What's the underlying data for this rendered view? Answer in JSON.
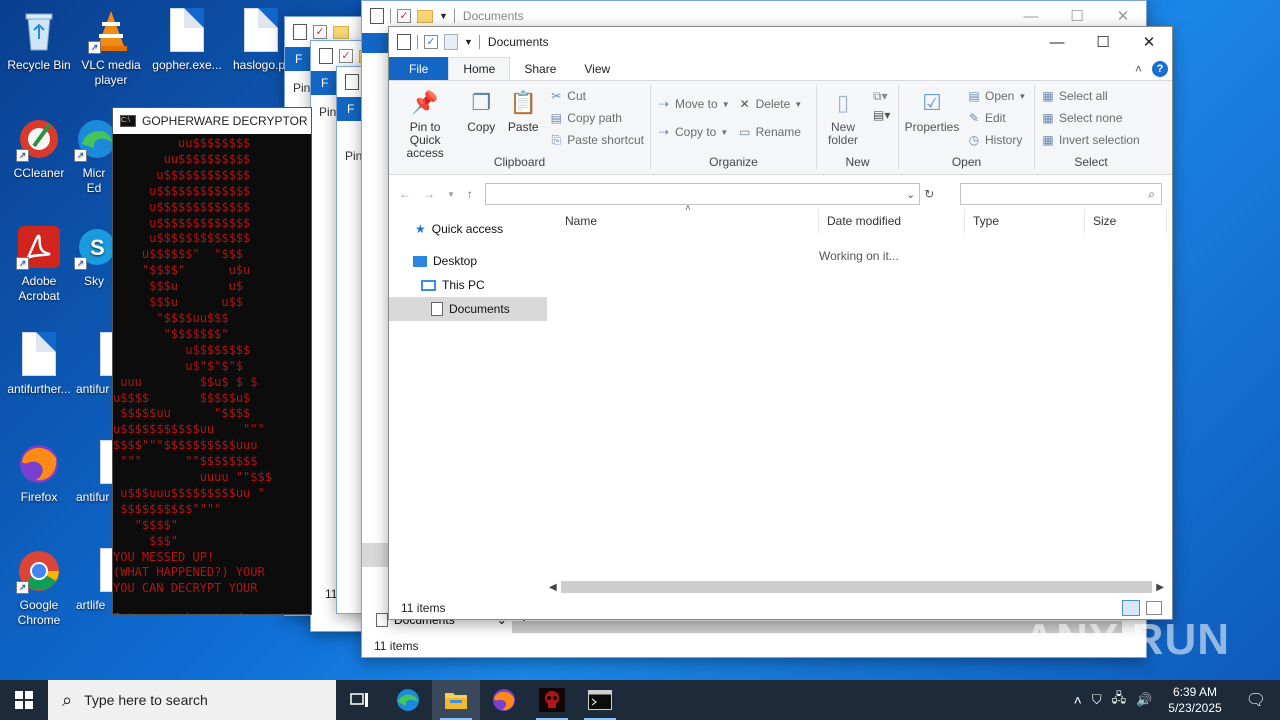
{
  "desktop": {
    "icons": [
      {
        "label": "Recycle Bin"
      },
      {
        "label": "VLC media player"
      },
      {
        "label": "gopher.exe..."
      },
      {
        "label": "haslogo.pr"
      },
      {
        "label": "CCleaner"
      },
      {
        "label": "Micr Ed"
      },
      {
        "label": "Adobe Acrobat"
      },
      {
        "label": "Sky"
      },
      {
        "label": "antifurther..."
      },
      {
        "label": "antifur"
      },
      {
        "label": "Firefox"
      },
      {
        "label": "antifur"
      },
      {
        "label": "Google Chrome"
      },
      {
        "label": "artlife"
      }
    ]
  },
  "console": {
    "title": "GOPHERWARE DECRYPTOR",
    "art": "         uu$$$$$$$$\n       uu$$$$$$$$$$\n      u$$$$$$$$$$$$\n     u$$$$$$$$$$$$$\n     u$$$$$$$$$$$$$\n     u$$$$$$$$$$$$$\n     u$$$$$$$$$$$$$\n    u$$$$$$\"  \"$$$\n    \"$$$$\"      u$u\n     $$$u       u$\n     $$$u      u$$\n      \"$$$$uu$$$\n       \"$$$$$$$\"  \n          u$$$$$$$$\n          u$\"$\"$\"$\n uuu        $$u$ $ $\nu$$$$       $$$$$u$\n $$$$$uu      \"$$$$\nu$$$$$$$$$$$uu    \"\"\"\n$$$$\"\"\"$$$$$$$$$$uuu\n \"\"\"      \"\"$$$$$$$$\n            uuuu \"\"$$$\n u$$$uuu$$$$$$$$$uu \"\n $$$$$$$$$$\"\"\"\"\n   \"$$$$\"\n     $$$\"",
    "line1": "YOU MESSED UP!",
    "line2": "(WHAT HAPPENED?) YOUR",
    "line3": "YOU CAN DECRYPT YOUR",
    "prompt": "Enter passkey to decrypt"
  },
  "back_windows": {
    "pin": "Pin",
    "items_partial": "11",
    "f_tab": "F"
  },
  "explorer_back": {
    "title": "Documents",
    "status": "11 items",
    "nav_label": "Documents"
  },
  "explorer": {
    "title": "Documents",
    "tabs": [
      "File",
      "Home",
      "Share",
      "View"
    ],
    "clipboard": {
      "pin": "Pin to Quick access",
      "copy": "Copy",
      "paste": "Paste",
      "cut": "Cut",
      "copy_path": "Copy path",
      "paste_shortcut": "Paste shortcut",
      "label": "Clipboard"
    },
    "organize": {
      "move_to": "Move to",
      "copy_to": "Copy to",
      "delete": "Delete",
      "rename": "Rename",
      "label": "Organize"
    },
    "new": {
      "new_folder": "New folder",
      "label": "New"
    },
    "open": {
      "properties": "Properties",
      "open": "Open",
      "edit": "Edit",
      "history": "History",
      "label": "Open"
    },
    "select": {
      "select_all": "Select all",
      "select_none": "Select none",
      "invert": "Invert selection",
      "label": "Select"
    },
    "nav": {
      "quick_access": "Quick access",
      "desktop": "Desktop",
      "this_pc": "This PC",
      "documents": "Documents"
    },
    "columns": [
      "Name",
      "Date modified",
      "Type",
      "Size"
    ],
    "working": "Working on it...",
    "status": "11 items"
  },
  "taskbar": {
    "search_placeholder": "Type here to search",
    "time": "6:39 AM",
    "date": "5/23/2025"
  },
  "watermark": "ANY RUN"
}
